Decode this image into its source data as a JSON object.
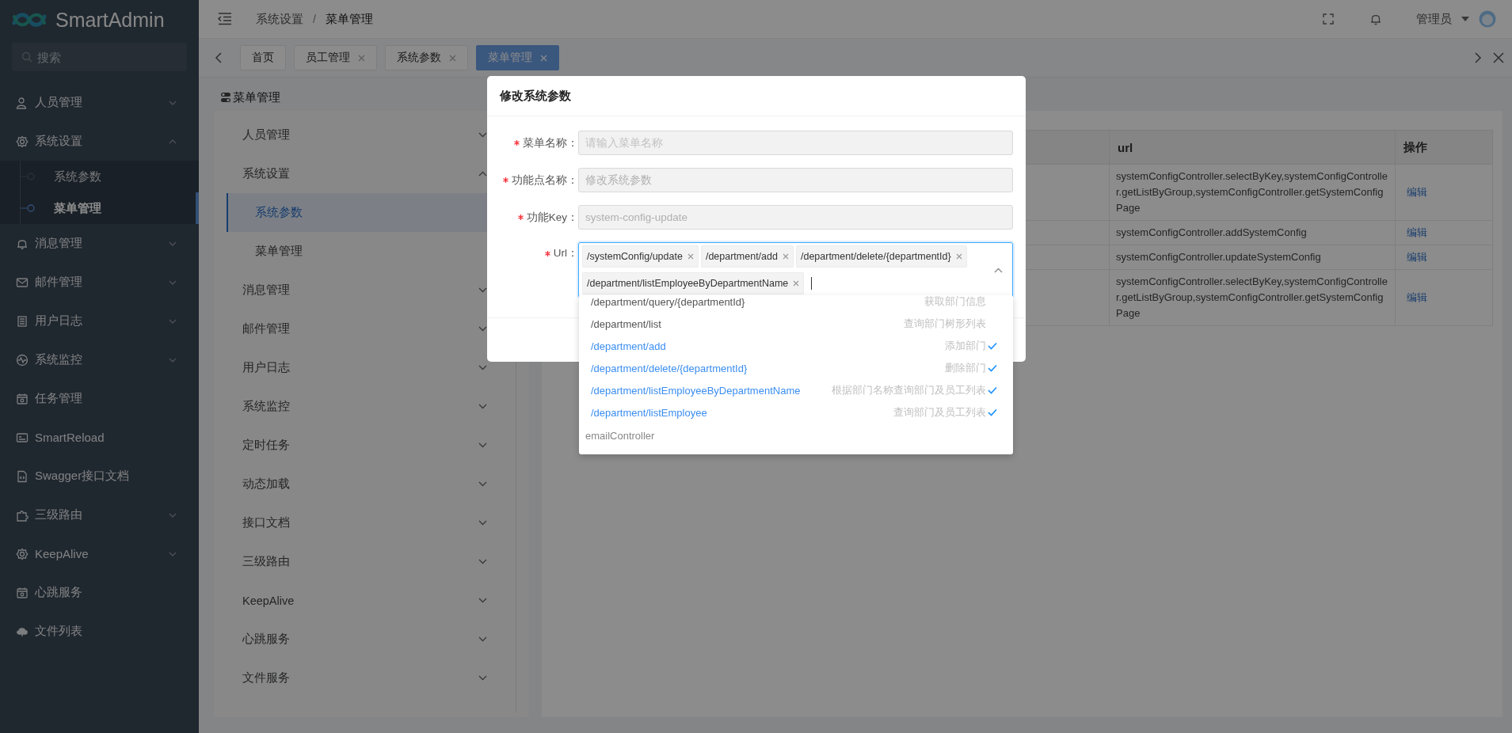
{
  "sidebar": {
    "logo": "SmartAdmin",
    "search": {
      "placeholder": "搜索"
    },
    "items": [
      {
        "label": "人员管理",
        "kind": "group",
        "expanded": false
      },
      {
        "label": "系统设置",
        "kind": "group",
        "expanded": true,
        "children": [
          {
            "label": "系统参数",
            "selected": false
          },
          {
            "label": "菜单管理",
            "selected": true
          }
        ]
      },
      {
        "label": "消息管理",
        "kind": "group",
        "expanded": false
      },
      {
        "label": "邮件管理",
        "kind": "group",
        "expanded": false
      },
      {
        "label": "用户日志",
        "kind": "group",
        "expanded": false
      },
      {
        "label": "系统监控",
        "kind": "group",
        "expanded": false
      },
      {
        "label": "任务管理",
        "kind": "link"
      },
      {
        "label": "SmartReload",
        "kind": "link"
      },
      {
        "label": "Swagger接口文档",
        "kind": "link"
      },
      {
        "label": "三级路由",
        "kind": "group",
        "expanded": false
      },
      {
        "label": "KeepAlive",
        "kind": "group",
        "expanded": false
      },
      {
        "label": "心跳服务",
        "kind": "link"
      },
      {
        "label": "文件列表",
        "kind": "link"
      }
    ]
  },
  "header": {
    "breadcrumb": [
      "系统设置",
      "菜单管理"
    ],
    "breadcrumb_separator": "/",
    "user": "管理员"
  },
  "tabs": [
    {
      "label": "首页",
      "closable": false,
      "selected": false
    },
    {
      "label": "员工管理",
      "closable": true,
      "selected": false
    },
    {
      "label": "系统参数",
      "closable": true,
      "selected": false
    },
    {
      "label": "菜单管理",
      "closable": true,
      "selected": true
    }
  ],
  "menu_panel": {
    "title": "菜单管理",
    "items": [
      {
        "label": "人员管理",
        "expanded": false
      },
      {
        "label": "系统设置",
        "expanded": true,
        "children": [
          {
            "label": "系统参数",
            "selected": true
          },
          {
            "label": "菜单管理",
            "selected": false
          }
        ]
      },
      {
        "label": "消息管理",
        "expanded": false
      },
      {
        "label": "邮件管理",
        "expanded": false
      },
      {
        "label": "用户日志",
        "expanded": false
      },
      {
        "label": "系统监控",
        "expanded": false
      },
      {
        "label": "定时任务",
        "expanded": false
      },
      {
        "label": "动态加载",
        "expanded": false
      },
      {
        "label": "接口文档",
        "expanded": false
      },
      {
        "label": "三级路由",
        "expanded": false
      },
      {
        "label": "KeepAlive",
        "expanded": false
      },
      {
        "label": "心跳服务",
        "expanded": false
      },
      {
        "label": "文件服务",
        "expanded": false
      }
    ]
  },
  "table": {
    "columns": [
      "url",
      "操作"
    ],
    "rows": [
      {
        "url": "systemConfigController.selectByKey,systemConfigController.getListByGroup,systemConfigController.getSystemConfigPage",
        "action": "编辑"
      },
      {
        "url": "systemConfigController.addSystemConfig",
        "action": "编辑"
      },
      {
        "url": "systemConfigController.updateSystemConfig",
        "action": "编辑"
      },
      {
        "url": "systemConfigController.selectByKey,systemConfigController.getListByGroup,systemConfigController.getSystemConfigPage",
        "action": "编辑"
      }
    ]
  },
  "modal": {
    "title": "修改系统参数",
    "fields": [
      {
        "label": "菜单名称：",
        "required": true,
        "disabled": true,
        "placeholder": "请输入菜单名称"
      },
      {
        "label": "功能点名称：",
        "required": true,
        "disabled": true,
        "value": "修改系统参数"
      },
      {
        "label": "功能Key：",
        "required": true,
        "disabled": true,
        "value": "system-config-update"
      }
    ],
    "url_field": {
      "label": "Url：",
      "required": true,
      "expanded": true,
      "tags": [
        "/systemConfig/update",
        "/department/add",
        "/department/delete/{departmentId}",
        "/department/listEmployeeByDepartmentName"
      ]
    },
    "dropdown": [
      {
        "kind": "option",
        "path": "/department/query/{departmentId}",
        "description": "获取部门信息",
        "selected": false
      },
      {
        "kind": "option",
        "path": "/department/list",
        "description": "查询部门树形列表",
        "selected": false
      },
      {
        "kind": "option",
        "path": "/department/add",
        "description": "添加部门",
        "selected": true
      },
      {
        "kind": "option",
        "path": "/department/delete/{departmentId}",
        "description": "删除部门",
        "selected": true
      },
      {
        "kind": "option",
        "path": "/department/listEmployeeByDepartmentName",
        "description": "根据部门名称查询部门及员工列表",
        "selected": true
      },
      {
        "kind": "option",
        "path": "/department/listEmployee",
        "description": "查询部门及员工列表",
        "selected": true
      },
      {
        "kind": "group",
        "label": "emailController"
      }
    ]
  }
}
